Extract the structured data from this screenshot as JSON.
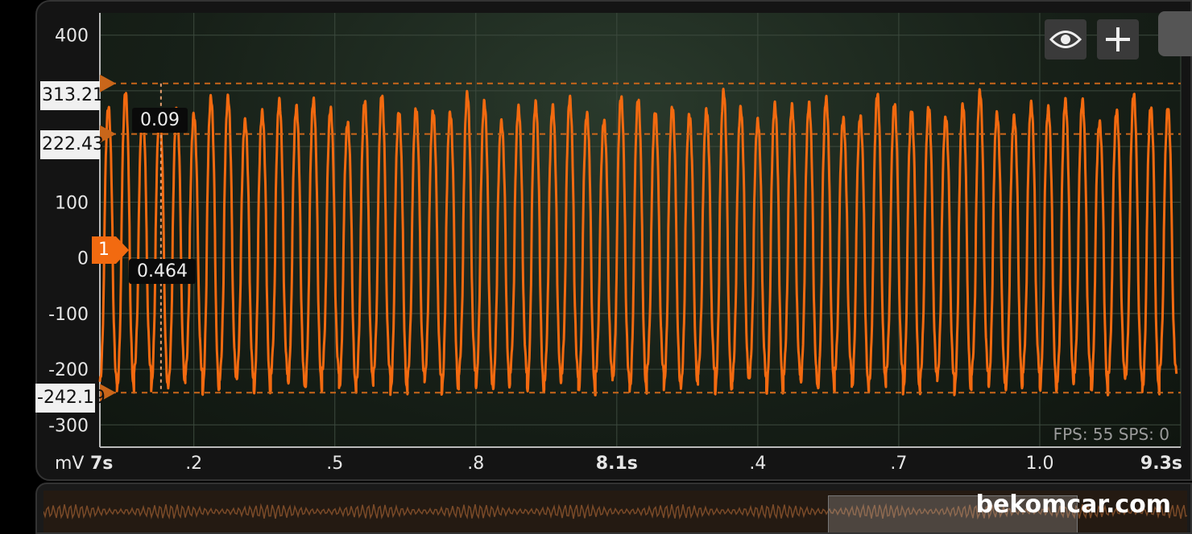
{
  "chart_data": {
    "type": "line",
    "unit": "mV",
    "ylim": [
      -340,
      440
    ],
    "y_ticks": [
      "400",
      "100",
      "0",
      "-100",
      "-200",
      "-300"
    ],
    "y_tick_values": [
      400,
      100,
      0,
      -100,
      -200,
      -300
    ],
    "x_ticks": [
      {
        "label": "7s",
        "t": 7.0,
        "bold": true
      },
      {
        "label": ".2",
        "t": 7.2,
        "bold": false
      },
      {
        "label": ".5",
        "t": 7.5,
        "bold": false
      },
      {
        "label": ".8",
        "t": 7.8,
        "bold": false
      },
      {
        "label": "8.1s",
        "t": 8.1,
        "bold": true
      },
      {
        "label": ".4",
        "t": 8.4,
        "bold": false
      },
      {
        "label": ".7",
        "t": 8.7,
        "bold": false
      },
      {
        "label": "1.0",
        "t": 9.0,
        "bold": false
      },
      {
        "label": "9.3s",
        "t": 9.3,
        "bold": true
      }
    ],
    "xlim": [
      7.0,
      9.3
    ],
    "series": [
      {
        "color": "#f26a10",
        "frequency_hz": 27.5,
        "peak_min": 240,
        "peak_max": 300,
        "trough": -242
      }
    ],
    "grid": true,
    "cursors": {
      "horizontal": [
        313.21,
        222.43,
        -242.19
      ],
      "vertical_t": 7.13
    }
  },
  "labels": {
    "unit": "mV",
    "cursor_high": "313.21",
    "cursor_mid": "222.43",
    "cursor_low": "-242.19",
    "delta_time": "0.09",
    "cursor_value": "0.464",
    "channel": "1",
    "fps": "FPS: 55  SPS: 0",
    "watermark": "bekomcar.com"
  },
  "icons": {
    "eye": "eye-icon",
    "plus": "plus-icon"
  },
  "colors": {
    "trace": "#f26a10",
    "cursor": "#c9661a"
  }
}
